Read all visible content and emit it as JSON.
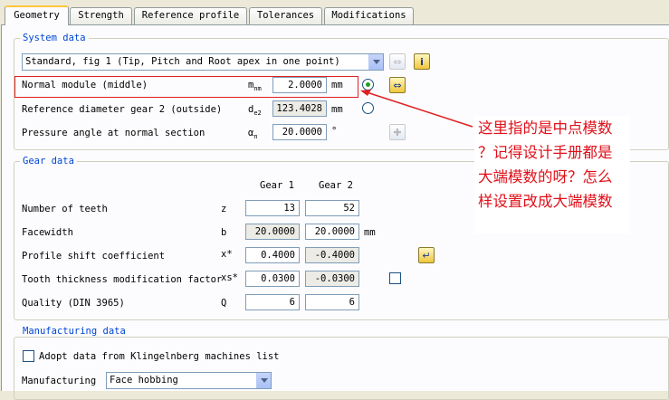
{
  "tabs": [
    "Geometry",
    "Strength",
    "Reference profile",
    "Tolerances",
    "Modifications"
  ],
  "system_data": {
    "title": "System data",
    "system_select": "Standard, fig 1 (Tip, Pitch and Root apex in one point)",
    "rows": [
      {
        "label": "Normal module (middle)",
        "symbol": "m",
        "symbol_sub": "nm",
        "value": "2.0000",
        "unit": "mm"
      },
      {
        "label": "Reference diameter gear 2 (outside)",
        "symbol": "d",
        "symbol_sub": "e2",
        "value": "123.4028",
        "unit": "mm"
      },
      {
        "label": "Pressure angle at normal section",
        "symbol": "α",
        "symbol_sub": "n",
        "value": "20.0000",
        "unit": "°"
      }
    ]
  },
  "gear_data": {
    "title": "Gear data",
    "col_gear1": "Gear 1",
    "col_gear2": "Gear 2",
    "rows": [
      {
        "label": "Number of teeth",
        "symbol": "z",
        "g1": "13",
        "g2": "52",
        "unit": ""
      },
      {
        "label": "Facewidth",
        "symbol": "b",
        "g1": "20.0000",
        "g2": "20.0000",
        "unit": "mm"
      },
      {
        "label": "Profile shift coefficient",
        "symbol": "x*",
        "g1": "0.4000",
        "g2": "-0.4000",
        "unit": ""
      },
      {
        "label": "Tooth thickness modification factor",
        "symbol": "xs*",
        "g1": "0.0300",
        "g2": "-0.0300",
        "unit": ""
      },
      {
        "label": "Quality (DIN 3965)",
        "symbol": "Q",
        "g1": "6",
        "g2": "6",
        "unit": ""
      }
    ]
  },
  "manufacturing_data": {
    "title": "Manufacturing data",
    "adopt_label": "Adopt data from Klingelnberg machines list",
    "manufacturing_label": "Manufacturing",
    "manufacturing_value": "Face hobbing"
  },
  "annotation": {
    "text": "这里指的是中点模数\n？记得设计手册都是\n大端模数的呀？怎么\n样设置改成大端模数"
  },
  "colors": {
    "annotation": "#e0101a",
    "group_title": "#0046d5",
    "tab_highlight": "#ffc83c"
  },
  "icons": {
    "system_swap": "double-arrow-icon",
    "system_info": "info-icon",
    "module_apply": "double-arrow-icon",
    "pressure_add": "plus-icon",
    "profile_shift_apply": "enter-arrow-icon"
  }
}
